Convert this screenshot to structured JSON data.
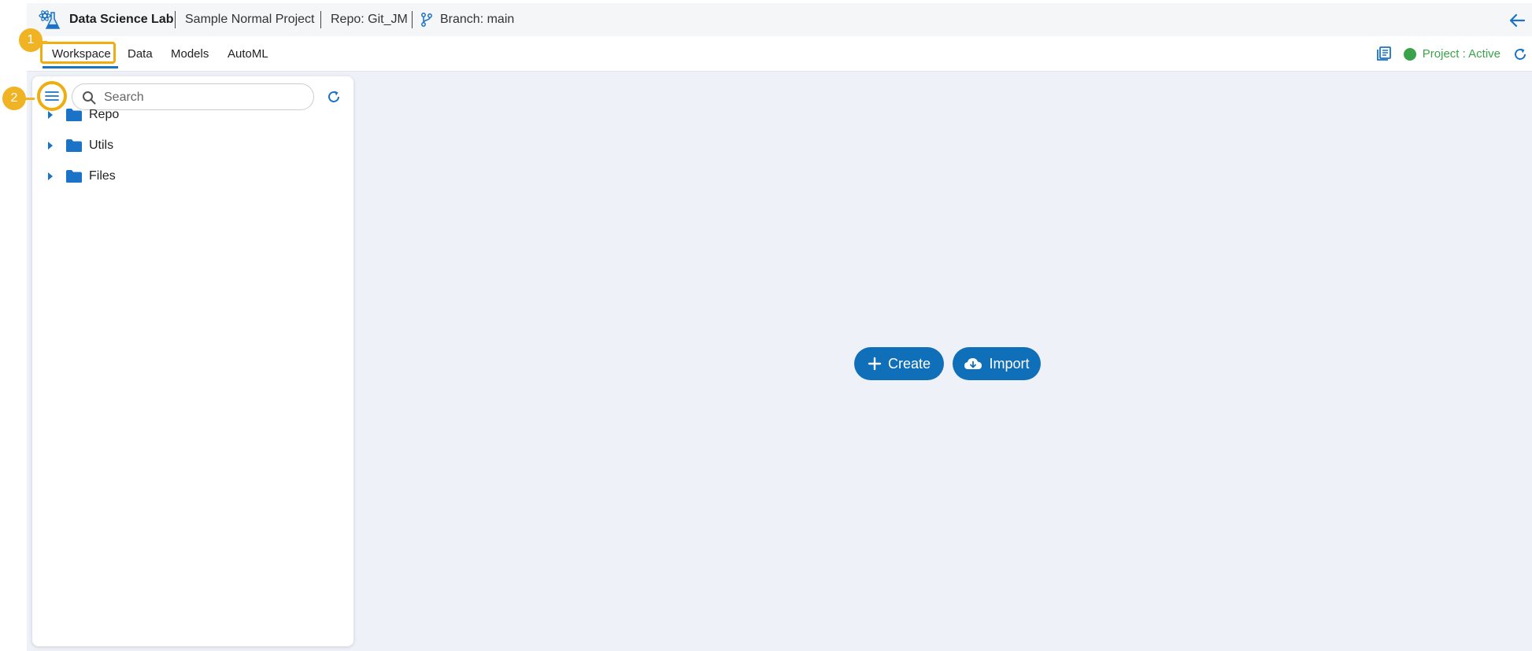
{
  "header": {
    "app_title": "Data Science Lab",
    "project_name": "Sample Normal Project",
    "repo": "Repo: Git_JM",
    "branch": "Branch: main"
  },
  "tabs": [
    {
      "label": "Workspace",
      "active": true
    },
    {
      "label": "Data",
      "active": false
    },
    {
      "label": "Models",
      "active": false
    },
    {
      "label": "AutoML",
      "active": false
    }
  ],
  "status": {
    "label": "Project : Active",
    "color": "#3aa34a"
  },
  "sidebar": {
    "search_placeholder": "Search",
    "tree": [
      {
        "label": "Repo",
        "icon": "folder-icon"
      },
      {
        "label": "Utils",
        "icon": "folder-icon"
      },
      {
        "label": "Files",
        "icon": "folder-icon"
      }
    ]
  },
  "actions": {
    "create_label": "Create",
    "import_label": "Import"
  },
  "callouts": {
    "one": "1",
    "two": "2"
  },
  "colors": {
    "accent": "#0f6fb8",
    "highlight": "#f0ad10",
    "background": "#eef1f8"
  }
}
